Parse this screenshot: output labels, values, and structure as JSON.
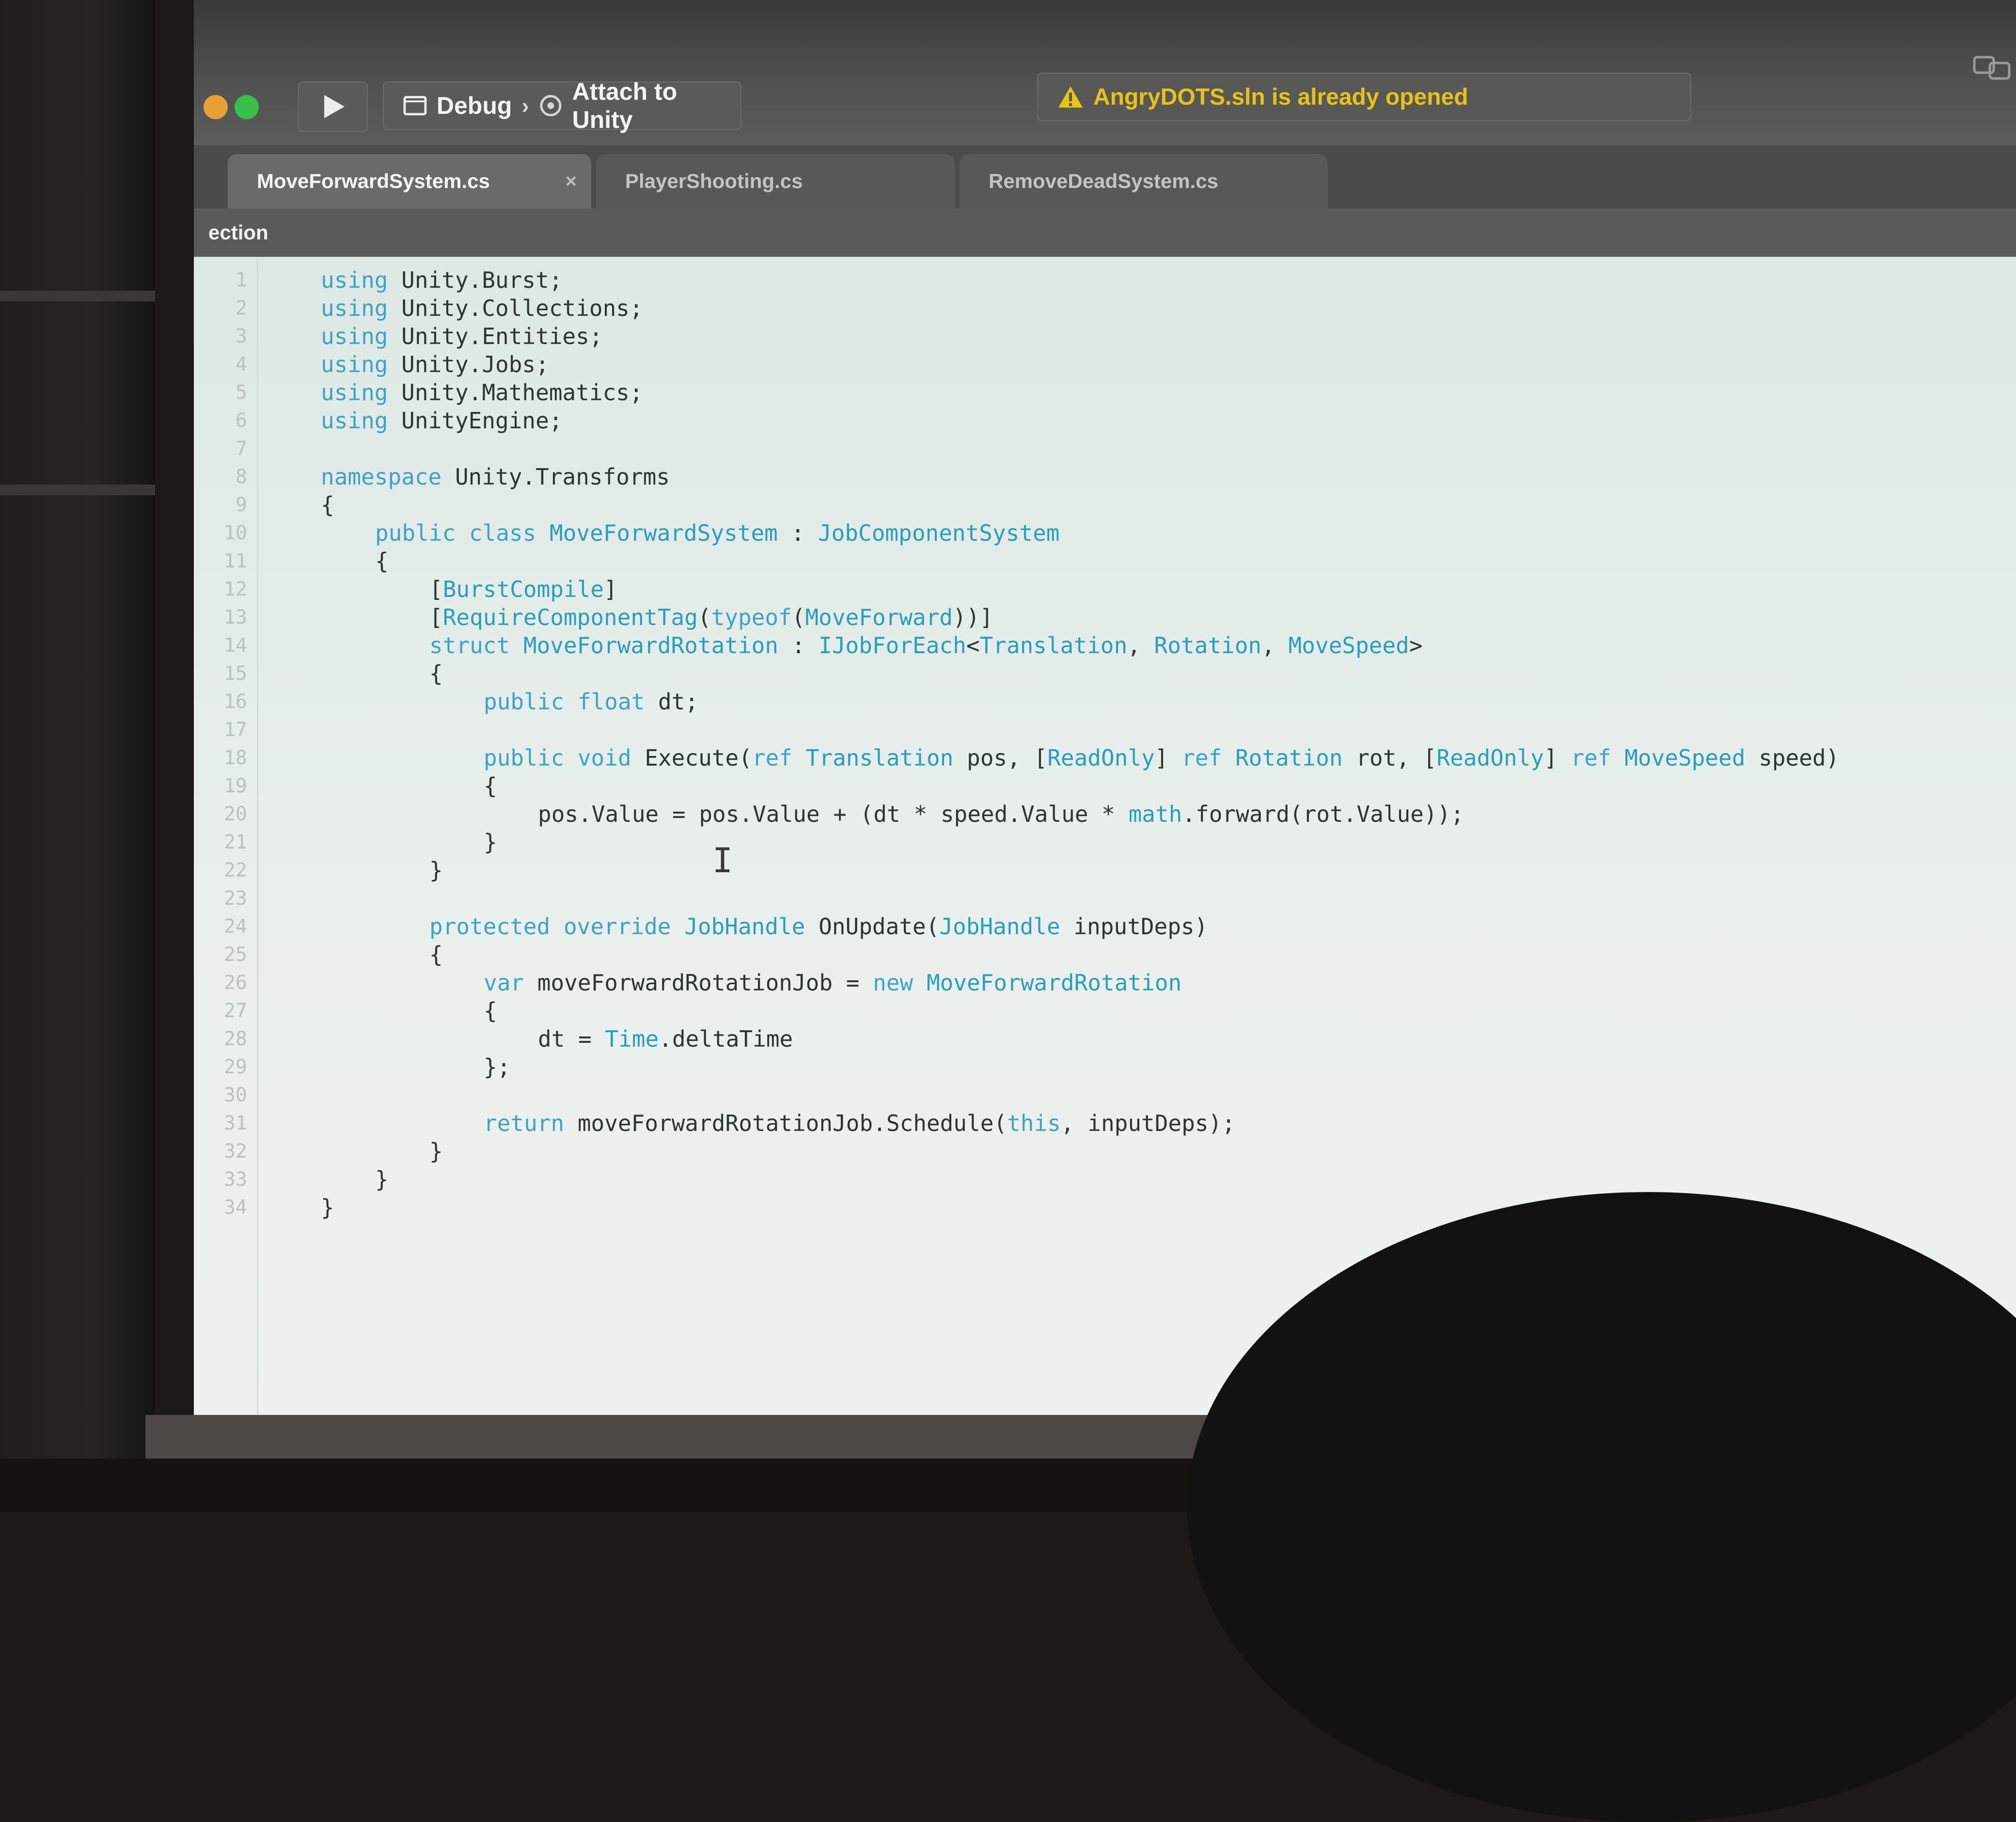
{
  "toolbar": {
    "scheme": "Debug",
    "target": "Attach to Unity",
    "status_message": "AngryDOTS.sln is already opened"
  },
  "tabs": [
    {
      "label": "MoveForwardSystem.cs",
      "active": true
    },
    {
      "label": "PlayerShooting.cs",
      "active": false
    },
    {
      "label": "RemoveDeadSystem.cs",
      "active": false
    }
  ],
  "jumpbar": {
    "label": "ection"
  },
  "code_lines": [
    {
      "n": "1",
      "indent": 1,
      "tokens": [
        [
          "kw",
          "using"
        ],
        [
          "t",
          " Unity.Burst;"
        ]
      ]
    },
    {
      "n": "2",
      "indent": 1,
      "tokens": [
        [
          "kw",
          "using"
        ],
        [
          "t",
          " Unity.Collections;"
        ]
      ]
    },
    {
      "n": "3",
      "indent": 1,
      "tokens": [
        [
          "kw",
          "using"
        ],
        [
          "t",
          " Unity.Entities;"
        ]
      ]
    },
    {
      "n": "4",
      "indent": 1,
      "tokens": [
        [
          "kw",
          "using"
        ],
        [
          "t",
          " Unity.Jobs;"
        ]
      ]
    },
    {
      "n": "5",
      "indent": 1,
      "tokens": [
        [
          "kw",
          "using"
        ],
        [
          "t",
          " Unity.Mathematics;"
        ]
      ]
    },
    {
      "n": "6",
      "indent": 1,
      "tokens": [
        [
          "kw",
          "using"
        ],
        [
          "t",
          " UnityEngine;"
        ]
      ]
    },
    {
      "n": "7",
      "indent": 0,
      "tokens": []
    },
    {
      "n": "8",
      "indent": 1,
      "tokens": [
        [
          "kw",
          "namespace"
        ],
        [
          "t",
          " Unity.Transforms"
        ]
      ]
    },
    {
      "n": "9",
      "indent": 1,
      "tokens": [
        [
          "t",
          "{"
        ]
      ]
    },
    {
      "n": "10",
      "indent": 2,
      "tokens": [
        [
          "kw",
          "public class"
        ],
        [
          "t",
          " "
        ],
        [
          "ty",
          "MoveForwardSystem"
        ],
        [
          "t",
          " : "
        ],
        [
          "ty",
          "JobComponentSystem"
        ]
      ]
    },
    {
      "n": "11",
      "indent": 2,
      "tokens": [
        [
          "t",
          "{"
        ]
      ]
    },
    {
      "n": "12",
      "indent": 3,
      "tokens": [
        [
          "t",
          "["
        ],
        [
          "ty",
          "BurstCompile"
        ],
        [
          "t",
          "]"
        ]
      ]
    },
    {
      "n": "13",
      "indent": 3,
      "tokens": [
        [
          "t",
          "["
        ],
        [
          "ty",
          "RequireComponentTag"
        ],
        [
          "t",
          "("
        ],
        [
          "kw",
          "typeof"
        ],
        [
          "t",
          "("
        ],
        [
          "ty",
          "MoveForward"
        ],
        [
          "t",
          "))]"
        ]
      ]
    },
    {
      "n": "14",
      "indent": 3,
      "tokens": [
        [
          "kw",
          "struct"
        ],
        [
          "t",
          " "
        ],
        [
          "ty",
          "MoveForwardRotation"
        ],
        [
          "t",
          " : "
        ],
        [
          "ty",
          "IJobForEach"
        ],
        [
          "t",
          "<"
        ],
        [
          "ty",
          "Translation"
        ],
        [
          "t",
          ", "
        ],
        [
          "ty",
          "Rotation"
        ],
        [
          "t",
          ", "
        ],
        [
          "ty",
          "MoveSpeed"
        ],
        [
          "t",
          ">"
        ]
      ]
    },
    {
      "n": "15",
      "indent": 3,
      "tokens": [
        [
          "t",
          "{"
        ]
      ]
    },
    {
      "n": "16",
      "indent": 4,
      "tokens": [
        [
          "kw",
          "public float"
        ],
        [
          "t",
          " dt;"
        ]
      ]
    },
    {
      "n": "17",
      "indent": 0,
      "tokens": []
    },
    {
      "n": "18",
      "indent": 4,
      "tokens": [
        [
          "kw",
          "public void"
        ],
        [
          "t",
          " Execute("
        ],
        [
          "kw",
          "ref"
        ],
        [
          "t",
          " "
        ],
        [
          "ty",
          "Translation"
        ],
        [
          "t",
          " pos, ["
        ],
        [
          "ty",
          "ReadOnly"
        ],
        [
          "t",
          "] "
        ],
        [
          "kw",
          "ref"
        ],
        [
          "t",
          " "
        ],
        [
          "ty",
          "Rotation"
        ],
        [
          "t",
          " rot, ["
        ],
        [
          "ty",
          "ReadOnly"
        ],
        [
          "t",
          "] "
        ],
        [
          "kw",
          "ref"
        ],
        [
          "t",
          " "
        ],
        [
          "ty",
          "MoveSpeed"
        ],
        [
          "t",
          " speed)"
        ]
      ]
    },
    {
      "n": "19",
      "indent": 4,
      "tokens": [
        [
          "t",
          "{"
        ]
      ]
    },
    {
      "n": "20",
      "indent": 5,
      "tokens": [
        [
          "t",
          "pos.Value = pos.Value + (dt * speed.Value * "
        ],
        [
          "ty",
          "math"
        ],
        [
          "t",
          ".forward(rot.Value));"
        ]
      ]
    },
    {
      "n": "21",
      "indent": 4,
      "tokens": [
        [
          "t",
          "}"
        ]
      ]
    },
    {
      "n": "22",
      "indent": 3,
      "tokens": [
        [
          "t",
          "}"
        ]
      ]
    },
    {
      "n": "23",
      "indent": 0,
      "tokens": []
    },
    {
      "n": "24",
      "indent": 3,
      "tokens": [
        [
          "kw",
          "protected override"
        ],
        [
          "t",
          " "
        ],
        [
          "ty",
          "JobHandle"
        ],
        [
          "t",
          " OnUpdate("
        ],
        [
          "ty",
          "JobHandle"
        ],
        [
          "t",
          " inputDeps)"
        ]
      ]
    },
    {
      "n": "25",
      "indent": 3,
      "tokens": [
        [
          "t",
          "{"
        ]
      ]
    },
    {
      "n": "26",
      "indent": 4,
      "tokens": [
        [
          "kw",
          "var"
        ],
        [
          "t",
          " moveForwardRotationJob = "
        ],
        [
          "kw",
          "new"
        ],
        [
          "t",
          " "
        ],
        [
          "ty",
          "MoveForwardRotation"
        ]
      ]
    },
    {
      "n": "27",
      "indent": 4,
      "tokens": [
        [
          "t",
          "{"
        ]
      ]
    },
    {
      "n": "28",
      "indent": 5,
      "tokens": [
        [
          "t",
          "dt = "
        ],
        [
          "ty",
          "Time"
        ],
        [
          "t",
          ".deltaTime"
        ]
      ]
    },
    {
      "n": "29",
      "indent": 4,
      "tokens": [
        [
          "t",
          "};"
        ]
      ]
    },
    {
      "n": "30",
      "indent": 0,
      "tokens": []
    },
    {
      "n": "31",
      "indent": 4,
      "tokens": [
        [
          "kw",
          "return"
        ],
        [
          "t",
          " moveForwardRotationJob.Schedule("
        ],
        [
          "kw",
          "this"
        ],
        [
          "t",
          ", inputDeps);"
        ]
      ]
    },
    {
      "n": "32",
      "indent": 3,
      "tokens": [
        [
          "t",
          "}"
        ]
      ]
    },
    {
      "n": "33",
      "indent": 2,
      "tokens": [
        [
          "t",
          "}"
        ]
      ]
    },
    {
      "n": "34",
      "indent": 1,
      "tokens": [
        [
          "t",
          "}"
        ]
      ]
    }
  ],
  "colors": {
    "keyword": "#3fa2c2",
    "type": "#2b9db8",
    "warning": "#e8c21a"
  },
  "icons": [
    "play-icon",
    "window-icon",
    "target-icon",
    "warning-icon",
    "close-icon",
    "text-cursor-icon"
  ]
}
